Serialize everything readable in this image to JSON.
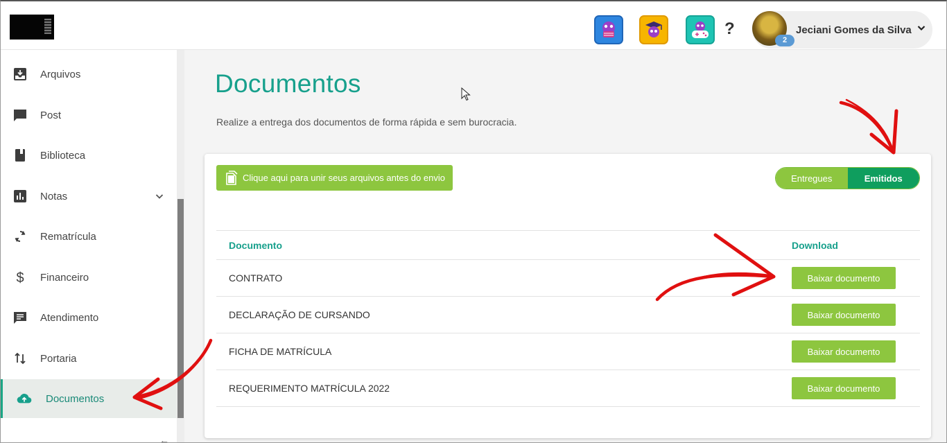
{
  "header": {
    "user_name": "Jeciani Gomes da Silva",
    "notification_count": "2",
    "help_label": "?",
    "icons": [
      "shopping-game-icon",
      "graduation-game-icon",
      "controller-game-icon"
    ]
  },
  "sidebar": {
    "items": [
      {
        "label": "Arquivos",
        "icon": "inbox-download-icon"
      },
      {
        "label": "Post",
        "icon": "chat-bubble-icon"
      },
      {
        "label": "Biblioteca",
        "icon": "book-icon"
      },
      {
        "label": "Notas",
        "icon": "bar-chart-icon"
      },
      {
        "label": "Rematrícula",
        "icon": "refresh-icon"
      },
      {
        "label": "Financeiro",
        "icon": "dollar-icon"
      },
      {
        "label": "Atendimento",
        "icon": "message-icon"
      },
      {
        "label": "Portaria",
        "icon": "swap-vertical-icon"
      },
      {
        "label": "Documentos",
        "icon": "cloud-upload-icon"
      }
    ],
    "collapse_label": "←"
  },
  "main": {
    "title": "Documentos",
    "subtitle": "Realize a entrega dos documentos de forma rápida e sem burocracia.",
    "merge_button_label": "Clique aqui para unir seus arquivos antes do envio",
    "toggle": {
      "entregues": "Entregues",
      "emitidos": "Emitidos"
    },
    "table": {
      "headers": [
        "Documento",
        "Download"
      ],
      "rows": [
        {
          "name": "CONTRATO",
          "action": "Baixar documento"
        },
        {
          "name": "DECLARAÇÃO DE CURSANDO",
          "action": "Baixar documento"
        },
        {
          "name": "FICHA DE MATRÍCULA",
          "action": "Baixar documento"
        },
        {
          "name": "REQUERIMENTO MATRÍCULA 2022",
          "action": "Baixar documento"
        }
      ]
    }
  },
  "colors": {
    "accent": "#17a08c",
    "button_green": "#8dc63f",
    "toggle_active": "#0f9e5e",
    "annotation_red": "#e01010"
  }
}
